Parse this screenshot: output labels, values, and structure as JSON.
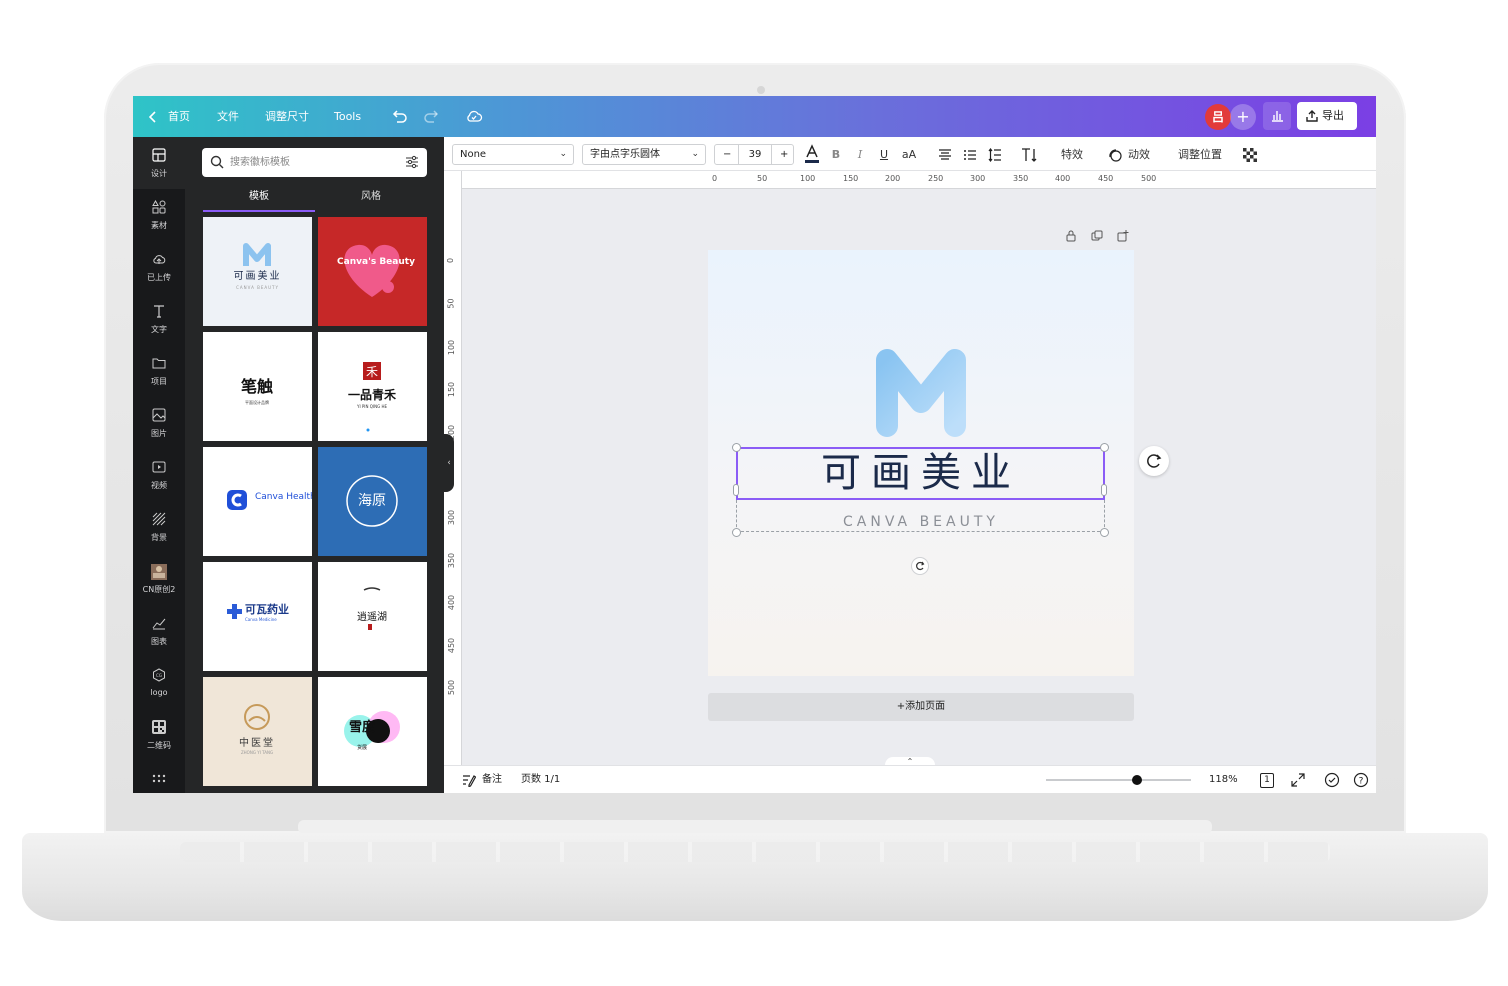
{
  "topbar": {
    "home": "首页",
    "file": "文件",
    "resize": "调整尺寸",
    "tools": "Tools",
    "avatar_initial": "吕",
    "export_label": "导出"
  },
  "rail": {
    "items": [
      {
        "label": "设计",
        "icon": "layout-icon"
      },
      {
        "label": "素材",
        "icon": "shapes-icon"
      },
      {
        "label": "已上传",
        "icon": "cloud-upload-icon"
      },
      {
        "label": "文字",
        "icon": "text-icon"
      },
      {
        "label": "项目",
        "icon": "folder-icon"
      },
      {
        "label": "图片",
        "icon": "image-icon"
      },
      {
        "label": "视频",
        "icon": "video-icon"
      },
      {
        "label": "背景",
        "icon": "background-icon"
      },
      {
        "label": "CN原创2",
        "icon": "app-thumbnail-icon"
      },
      {
        "label": "图表",
        "icon": "chart-icon"
      },
      {
        "label": "logo",
        "icon": "logo-icon"
      },
      {
        "label": "二维码",
        "icon": "qrcode-icon"
      }
    ]
  },
  "panel": {
    "search_placeholder": "搜索徽标模板",
    "tabs": [
      "模板",
      "风格"
    ],
    "templates": [
      {
        "title": "可画美业",
        "subtitle": "CANVA BEAUTY"
      },
      {
        "title": "Canva's Beauty"
      },
      {
        "title": "笔触",
        "subtitle": "平面设计品牌"
      },
      {
        "title": "一品青禾",
        "subtitle": "YI PIN QING HE",
        "stamp": "禾"
      },
      {
        "title": "Canva Health"
      },
      {
        "title": "海原"
      },
      {
        "title": "可瓦药业",
        "subtitle": "Canva Medicine"
      },
      {
        "title": "逍遥湖"
      },
      {
        "title": "中医堂",
        "subtitle": "ZHONG YI TANG"
      },
      {
        "title": "雪度",
        "subtitle": "货展"
      }
    ]
  },
  "toolbar": {
    "style_select": "None",
    "font_select": "字由点字乐圆体",
    "font_size": "39",
    "minus": "−",
    "plus": "+",
    "bold": "B",
    "italic": "I",
    "underline": "U",
    "case": "aA",
    "effects": "特效",
    "animate": "动效",
    "position": "调整位置"
  },
  "ruler": {
    "h_ticks": [
      "0",
      "50",
      "100",
      "150",
      "200",
      "250",
      "300",
      "350",
      "400",
      "450",
      "500"
    ],
    "v_ticks": [
      "0",
      "50",
      "100",
      "150",
      "200",
      "250",
      "300",
      "350",
      "400",
      "450",
      "500"
    ]
  },
  "canvas": {
    "brand_title": "可画美业",
    "brand_subtitle": "CANVA BEAUTY",
    "add_page": "+添加页面"
  },
  "bottombar": {
    "notes": "备注",
    "page_count": "页数 1/1",
    "zoom": "118%",
    "page_number": "1"
  },
  "colors": {
    "accent": "#8b5cf6",
    "gradient_start": "#2ec4c7",
    "gradient_end": "#7b3fe4",
    "avatar": "#e23a3a"
  }
}
